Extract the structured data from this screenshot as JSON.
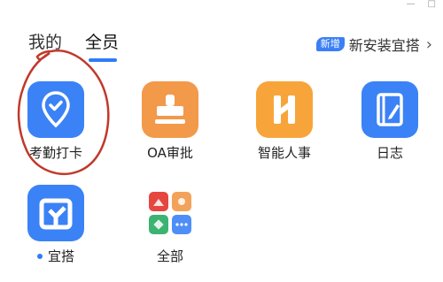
{
  "window_controls": {
    "minimize": "—",
    "maximize": "□"
  },
  "tabs": [
    {
      "label": "我的",
      "active": false
    },
    {
      "label": "全员",
      "active": true
    }
  ],
  "new_install": {
    "badge": "新增",
    "text": "新安装宜搭",
    "arrow": "›"
  },
  "apps": [
    {
      "label": "考勤打卡",
      "icon": "location-check-icon",
      "color": "#3b82f6"
    },
    {
      "label": "OA审批",
      "icon": "stamp-icon",
      "color": "#f3994a"
    },
    {
      "label": "智能人事",
      "icon": "h-logo-icon",
      "color": "#f7a53a"
    },
    {
      "label": "日志",
      "icon": "notebook-pen-icon",
      "color": "#3b82f6"
    },
    {
      "label": "宜搭",
      "icon": "yida-logo-icon",
      "color": "#3b82f6",
      "has_dot": true
    },
    {
      "label": "全部",
      "icon": "grid-apps-icon",
      "color": "#ffffff"
    }
  ],
  "annotation": {
    "color": "#c0392b"
  }
}
